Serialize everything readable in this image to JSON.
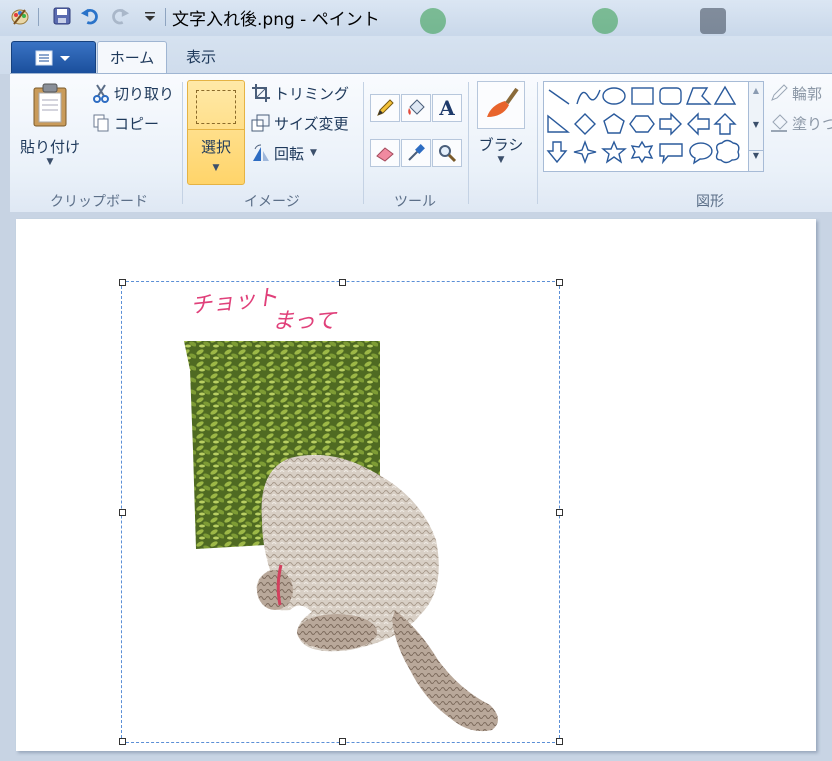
{
  "window": {
    "title": "文字入れ後.png - ペイント"
  },
  "tabs": {
    "home": "ホーム",
    "view": "表示"
  },
  "clipboard": {
    "paste": "貼り付け",
    "cut": "切り取り",
    "copy": "コピー",
    "group_label": "クリップボード"
  },
  "image": {
    "select": "選択",
    "crop": "トリミング",
    "resize": "サイズ変更",
    "rotate": "回転",
    "group_label": "イメージ"
  },
  "tools": {
    "group_label": "ツール"
  },
  "brushes": {
    "label": "ブラシ"
  },
  "shapes": {
    "group_label": "図形",
    "outline": "輪郭",
    "fill": "塗りつ"
  },
  "canvas": {
    "handwriting_line1": "チョット",
    "handwriting_line2": "まって",
    "handwriting_color": "#e0407a"
  },
  "colors": {
    "accent": "#1b4f9c",
    "selected_tool": "#ffd46a"
  }
}
